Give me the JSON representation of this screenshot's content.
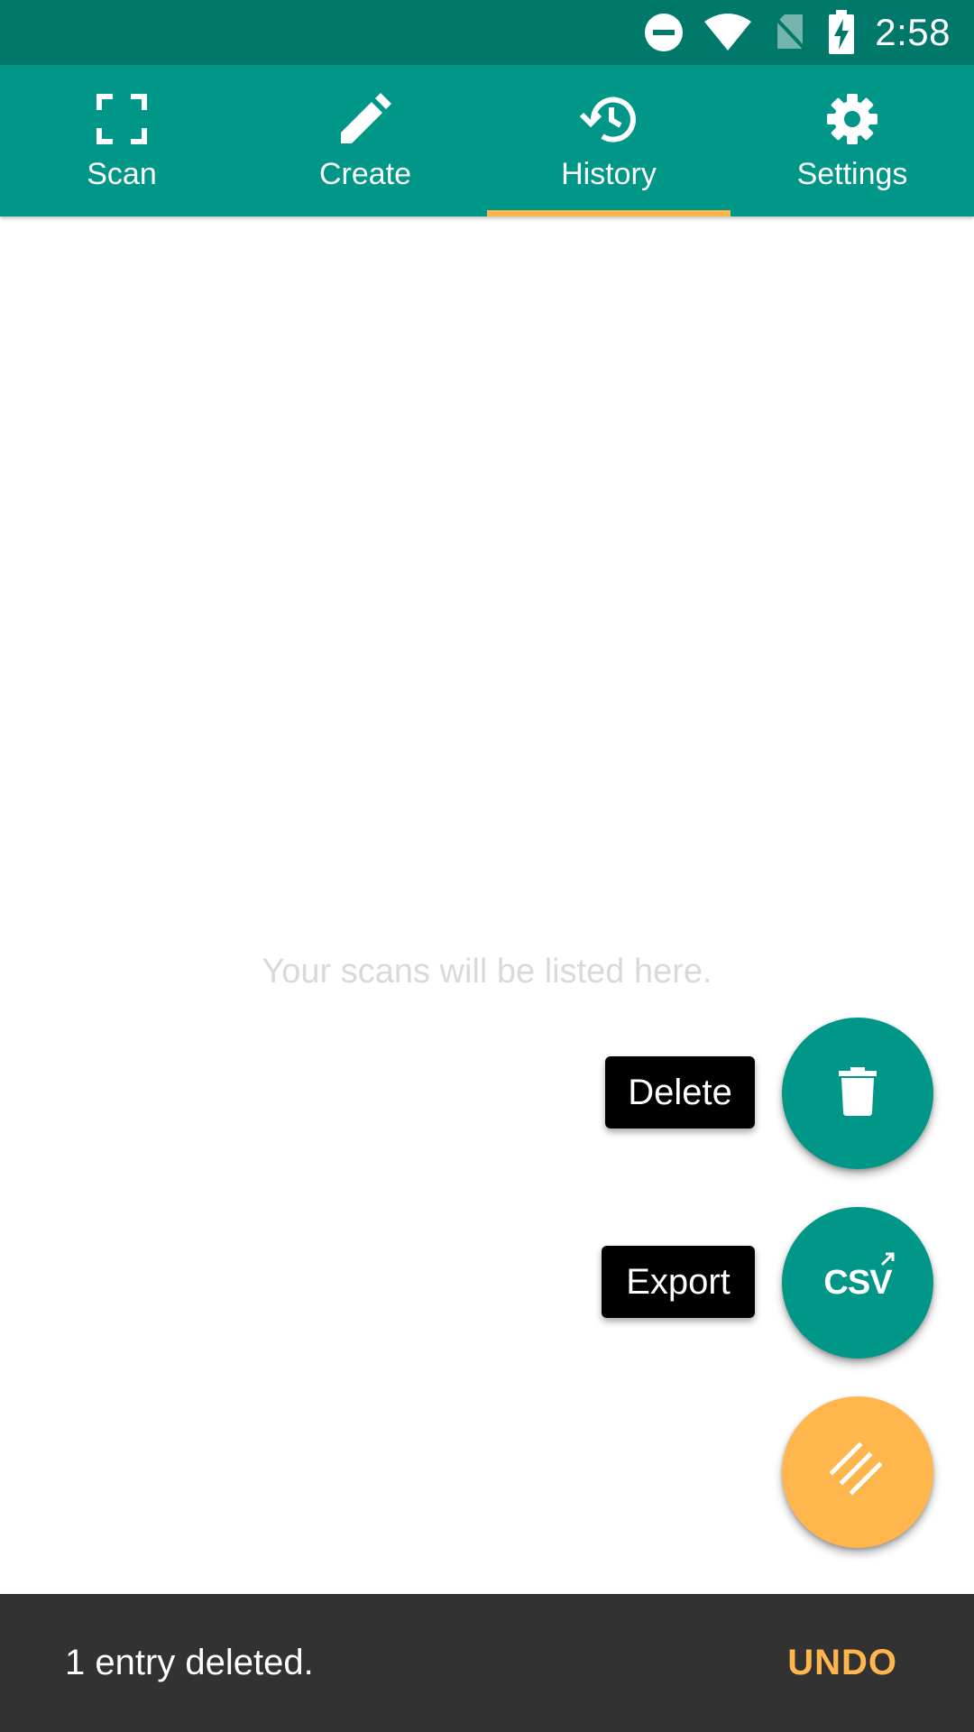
{
  "status_bar": {
    "time": "2:58",
    "icons": [
      "do-not-disturb-icon",
      "wifi-icon",
      "no-sim-icon",
      "battery-charging-icon"
    ]
  },
  "tabs": [
    {
      "label": "Scan",
      "icon": "scan-frame-icon",
      "selected": false
    },
    {
      "label": "Create",
      "icon": "pencil-icon",
      "selected": false
    },
    {
      "label": "History",
      "icon": "history-icon",
      "selected": true
    },
    {
      "label": "Settings",
      "icon": "gear-icon",
      "selected": false
    }
  ],
  "main": {
    "empty_message": "Your scans will be listed here."
  },
  "fab_menu": {
    "delete_label": "Delete",
    "export_label": "Export",
    "export_icon_text": "CSV",
    "main_icon": "diagonal-lines-icon"
  },
  "snackbar": {
    "message": "1 entry deleted.",
    "action": "UNDO"
  },
  "colors": {
    "primary": "#009688",
    "primary_dark": "#00796b",
    "accent": "#ffb74d",
    "snackbar_bg": "#323232"
  }
}
